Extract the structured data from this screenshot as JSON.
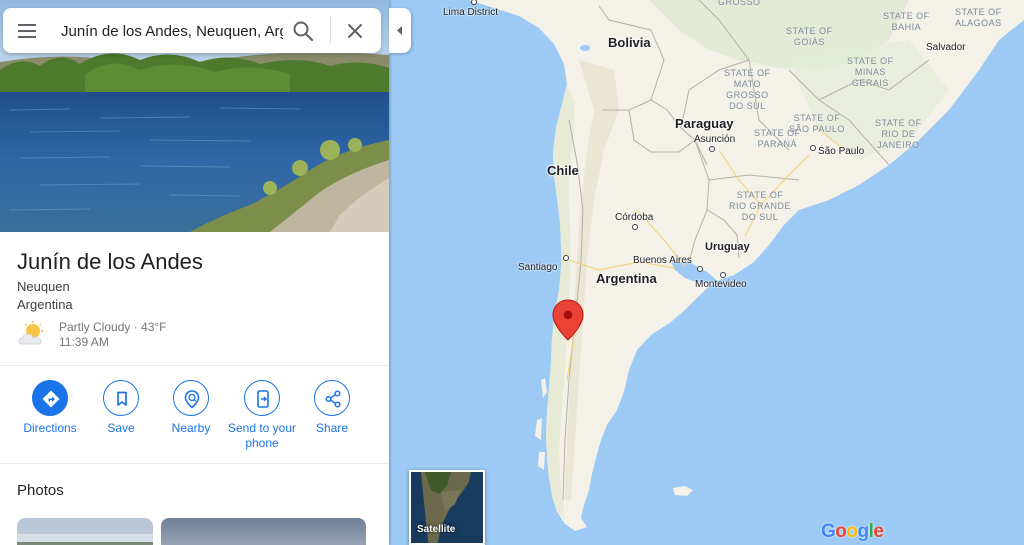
{
  "search": {
    "value": "Junín de los Andes, Neuquen, Argentina"
  },
  "place": {
    "name": "Junín de los Andes",
    "region": "Neuquen",
    "country": "Argentina",
    "weather": {
      "condition": "Partly Cloudy · 43°F",
      "time": "11:39 AM",
      "icon": "partly-cloudy-icon"
    }
  },
  "actions": [
    {
      "label": "Directions",
      "icon": "directions-icon"
    },
    {
      "label": "Save",
      "icon": "bookmark-icon"
    },
    {
      "label": "Nearby",
      "icon": "nearby-icon"
    },
    {
      "label": "Send to your phone",
      "icon": "send-to-phone-icon"
    },
    {
      "label": "Share",
      "icon": "share-icon"
    }
  ],
  "photos": {
    "heading": "Photos"
  },
  "map": {
    "countries": {
      "bolivia": "Bolivia",
      "paraguay": "Paraguay",
      "chile": "Chile",
      "argentina": "Argentina",
      "uruguay": "Uruguay"
    },
    "cities": {
      "lima_district": "Lima District",
      "asuncion": "Asunción",
      "sao_paulo": "São Paulo",
      "salvador": "Salvador",
      "cordoba": "Córdoba",
      "buenos_aires": "Buenos Aires",
      "montevideo": "Montevideo",
      "santiago": "Santiago"
    },
    "states": {
      "grosso": "GROSSO",
      "bahia": "STATE OF\nBAHIA",
      "alagoas": "STATE OF\nALAGOAS",
      "goias": "STATE OF\nGOIÁS",
      "mato_grosso_sul": "STATE OF\nMATO\nGROSSO\nDO SUL",
      "minas_gerais": "STATE OF\nMINAS\nGERAIS",
      "sao_paulo": "STATE OF\nSÃO PAULO",
      "rio_janeiro": "STATE OF\nRIO DE\nJANEIRO",
      "parana": "STATE OF\nPARANÁ",
      "rio_grande_sul": "STATE OF\nRIO GRANDE\nDO SUL"
    },
    "satellite_label": "Satellite",
    "logo": "Google",
    "colors": {
      "land": "#f3f1e8",
      "water": "#9ccaf5",
      "pin": "#ea4335",
      "accent": "#1a73e8"
    }
  }
}
